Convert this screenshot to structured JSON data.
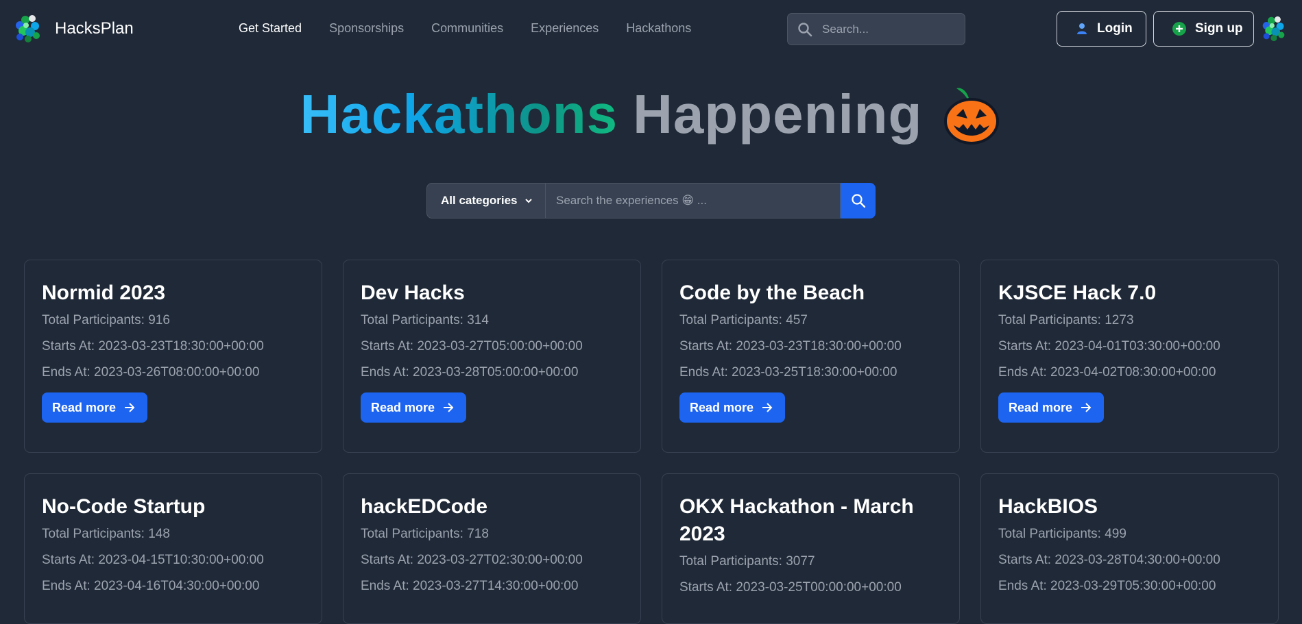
{
  "brand": {
    "name": "HacksPlan",
    "logo_icon": "hacksplan-logo-icon"
  },
  "nav": {
    "links": [
      {
        "label": "Get Started",
        "active": true
      },
      {
        "label": "Sponsorships",
        "active": false
      },
      {
        "label": "Communities",
        "active": false
      },
      {
        "label": "Experiences",
        "active": false
      },
      {
        "label": "Hackathons",
        "active": false
      }
    ]
  },
  "header_search": {
    "placeholder": "Search..."
  },
  "auth": {
    "login_label": "Login",
    "signup_label": "Sign up"
  },
  "hero": {
    "title_highlight": "Hackathons",
    "title_rest": "Happening",
    "emoji_icon": "jack-o-lantern-icon"
  },
  "filter": {
    "category_label": "All categories",
    "search_placeholder": "Search the experiences 😁 ..."
  },
  "colors": {
    "background": "#1f2937",
    "primary": "#1d64f0",
    "muted_text": "#9ca3af",
    "card_border": "#374151"
  },
  "hackathons": [
    {
      "title": "Normid 2023",
      "participants": "Total Participants: 916",
      "starts": "Starts At: 2023-03-23T18:30:00+00:00",
      "ends": "Ends At: 2023-03-26T08:00:00+00:00",
      "button": "Read more"
    },
    {
      "title": "Dev Hacks",
      "participants": "Total Participants: 314",
      "starts": "Starts At: 2023-03-27T05:00:00+00:00",
      "ends": "Ends At: 2023-03-28T05:00:00+00:00",
      "button": "Read more"
    },
    {
      "title": "Code by the Beach",
      "participants": "Total Participants: 457",
      "starts": "Starts At: 2023-03-23T18:30:00+00:00",
      "ends": "Ends At: 2023-03-25T18:30:00+00:00",
      "button": "Read more"
    },
    {
      "title": "KJSCE Hack 7.0",
      "participants": "Total Participants: 1273",
      "starts": "Starts At: 2023-04-01T03:30:00+00:00",
      "ends": "Ends At: 2023-04-02T08:30:00+00:00",
      "button": "Read more"
    },
    {
      "title": "No-Code Startup",
      "participants": "Total Participants: 148",
      "starts": "Starts At: 2023-04-15T10:30:00+00:00",
      "ends": "Ends At: 2023-04-16T04:30:00+00:00"
    },
    {
      "title": "hackEDCode",
      "participants": "Total Participants: 718",
      "starts": "Starts At: 2023-03-27T02:30:00+00:00",
      "ends": "Ends At: 2023-03-27T14:30:00+00:00"
    },
    {
      "title": "OKX Hackathon - March 2023",
      "participants": "Total Participants: 3077",
      "starts": "Starts At: 2023-03-25T00:00:00+00:00"
    },
    {
      "title": "HackBIOS",
      "participants": "Total Participants: 499",
      "starts": "Starts At: 2023-03-28T04:30:00+00:00",
      "ends": "Ends At: 2023-03-29T05:30:00+00:00"
    }
  ]
}
